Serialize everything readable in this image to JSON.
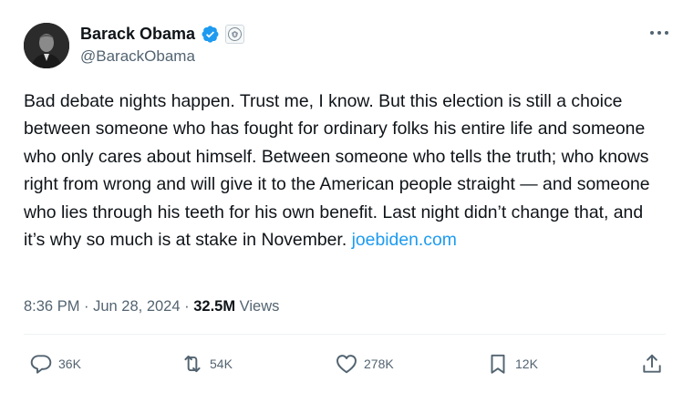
{
  "author": {
    "display_name": "Barack Obama",
    "handle": "@BarackObama",
    "verified_badge_icon": "verified-badge-icon",
    "affiliation_icon": "us-seal-icon",
    "verified_color": "#1d9bf0"
  },
  "tweet": {
    "text_main": "Bad debate nights happen. Trust me, I know. But this election is still a choice between someone who has fought for ordinary folks his entire life and someone who only cares about himself. Between someone who tells the truth; who knows right from wrong and will give it to the American people straight — and someone who lies through his teeth for his own benefit. Last night didn’t change that, and it’s why so much is at stake in November. ",
    "link_text": "joebiden.com",
    "link_color": "#1d9bf0"
  },
  "meta": {
    "time": "8:36 PM",
    "separator": " · ",
    "date": "Jun 28, 2024",
    "views_count": "32.5M",
    "views_label": " Views"
  },
  "actions": {
    "replies": "36K",
    "reposts": "54K",
    "likes": "278K",
    "bookmarks": "12K"
  },
  "colors": {
    "text": "#0f1419",
    "secondary": "#536471",
    "divider": "#eff3f4"
  }
}
